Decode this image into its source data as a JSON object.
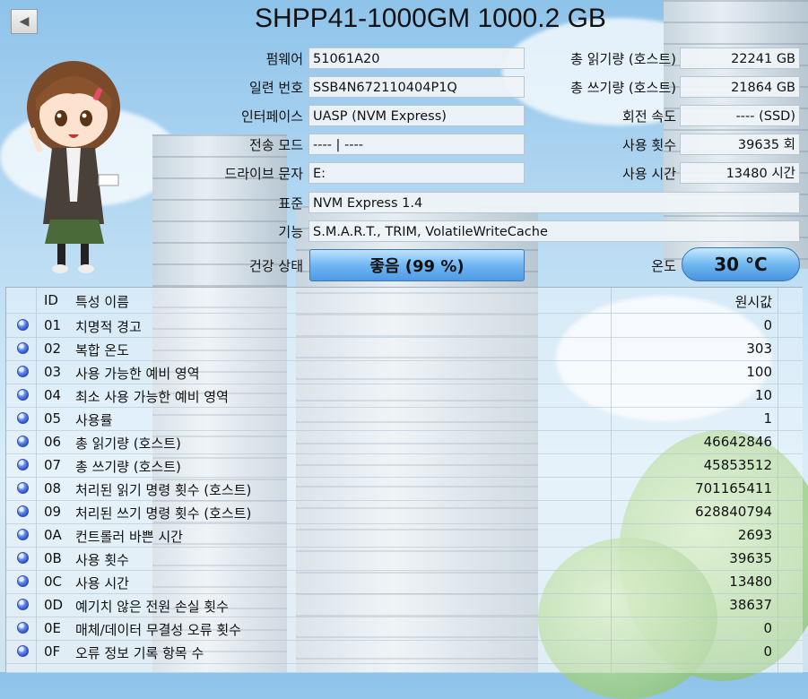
{
  "header": {
    "back_icon": "left-arrow-icon",
    "title": "SHPP41-1000GM 1000.2 GB"
  },
  "info": {
    "firmware_label": "펌웨어",
    "firmware": "51061A20",
    "serial_label": "일련 번호",
    "serial": "SSB4N672110404P1Q",
    "interface_label": "인터페이스",
    "interface": "UASP (NVM Express)",
    "transfer_label": "전송 모드",
    "transfer": "---- | ----",
    "drive_label": "드라이브 문자",
    "drive": "E:",
    "standard_label": "표준",
    "standard": "NVM Express 1.4",
    "features_label": "기능",
    "features": "S.M.A.R.T., TRIM, VolatileWriteCache",
    "health_label": "건강 상태",
    "health": "좋음  (99 %)",
    "host_reads_label": "총 읽기량 (호스트)",
    "host_reads": "22241 GB",
    "host_writes_label": "총 쓰기량 (호스트)",
    "host_writes": "21864 GB",
    "rotation_label": "회전 속도",
    "rotation": "---- (SSD)",
    "power_count_label": "사용 횟수",
    "power_count": "39635 회",
    "power_hours_label": "사용 시간",
    "power_hours": "13480 시간",
    "temp_label": "온도",
    "temp": "30 °C"
  },
  "colors": {
    "health_good": "#6fb6f3",
    "status_dot": "#2c4fc9"
  },
  "table": {
    "headers": {
      "id": "ID",
      "name": "특성 이름",
      "raw": "원시값"
    },
    "rows": [
      {
        "id": "01",
        "name": "치명적 경고",
        "raw": "0"
      },
      {
        "id": "02",
        "name": "복합 온도",
        "raw": "303"
      },
      {
        "id": "03",
        "name": "사용 가능한 예비 영역",
        "raw": "100"
      },
      {
        "id": "04",
        "name": "최소 사용 가능한 예비 영역",
        "raw": "10"
      },
      {
        "id": "05",
        "name": "사용률",
        "raw": "1"
      },
      {
        "id": "06",
        "name": "총 읽기량 (호스트)",
        "raw": "46642846"
      },
      {
        "id": "07",
        "name": "총 쓰기량 (호스트)",
        "raw": "45853512"
      },
      {
        "id": "08",
        "name": "처리된 읽기 명령 횟수 (호스트)",
        "raw": "701165411"
      },
      {
        "id": "09",
        "name": "처리된 쓰기 명령 횟수 (호스트)",
        "raw": "628840794"
      },
      {
        "id": "0A",
        "name": "컨트롤러 바쁜 시간",
        "raw": "2693"
      },
      {
        "id": "0B",
        "name": "사용 횟수",
        "raw": "39635"
      },
      {
        "id": "0C",
        "name": "사용 시간",
        "raw": "13480"
      },
      {
        "id": "0D",
        "name": "예기치 않은 전원 손실 횟수",
        "raw": "38637"
      },
      {
        "id": "0E",
        "name": "매체/데이터 무결성 오류 횟수",
        "raw": "0"
      },
      {
        "id": "0F",
        "name": "오류 정보 기록 항목 수",
        "raw": "0"
      }
    ]
  }
}
